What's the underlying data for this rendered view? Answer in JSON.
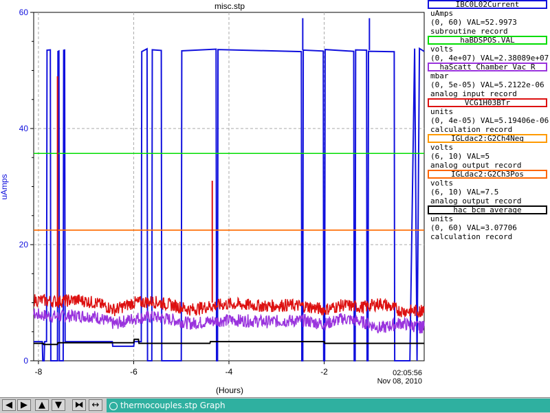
{
  "chart_data": {
    "type": "line",
    "title": "misc.stp",
    "xlabel": "(Hours)",
    "ylabel": "uAmps",
    "xlim": [
      -8.1,
      0.1
    ],
    "ylim": [
      0,
      60
    ],
    "x_ticks": [
      "-8",
      "-6",
      "-4",
      "-2"
    ],
    "y_ticks": [
      "0",
      "20",
      "40",
      "60"
    ],
    "time_label": "02:05:56",
    "date_label": "Nov 08, 2010",
    "grid": true,
    "series": [
      {
        "name": "IBC0L02Current",
        "color": "#1010dd",
        "x": [
          -8.1,
          -7.92,
          -7.91,
          -7.88,
          -7.87,
          -7.83,
          -7.82,
          -7.75,
          -7.74,
          -7.6,
          -7.59,
          -7.57,
          -7.56,
          -7.48,
          -7.47,
          -7.45,
          -7.44,
          -6.45,
          -6.44,
          -6.0,
          -5.99,
          -5.92,
          -5.9,
          -5.84,
          -5.83,
          -5.72,
          -5.71,
          -5.62,
          -5.61,
          -5.42,
          -5.41,
          -5.0,
          -4.99,
          -4.27,
          -4.26,
          -4.24,
          -4.23,
          -2.48,
          -2.47,
          -2.45,
          -2.44,
          -2.02,
          -2.01,
          -1.99,
          -1.98,
          -1.38,
          -1.37,
          -1.35,
          -1.34,
          -1.11,
          -1.1,
          -1.08,
          -1.07,
          -0.53,
          -0.52,
          -0.5,
          -0.45,
          -0.2,
          -0.1,
          -0.05,
          0.0,
          0.1
        ],
        "y": [
          3.3,
          3.3,
          0,
          0,
          3.3,
          3.3,
          53.5,
          53.5,
          0,
          0,
          53.5,
          53.5,
          0,
          0,
          53.5,
          53.5,
          3.3,
          3.3,
          2.5,
          2.5,
          3.3,
          3.3,
          3.3,
          3.3,
          53.5,
          53.5,
          0,
          0,
          53.5,
          53.5,
          0,
          0,
          53.5,
          53.5,
          0,
          0,
          53.5,
          53.5,
          0,
          0,
          53.5,
          53.5,
          0,
          0,
          53.5,
          53.5,
          0,
          0,
          53.5,
          53.5,
          0,
          0,
          53.5,
          53.5,
          0,
          0,
          0,
          0,
          53.5,
          0,
          53.5,
          53.5
        ]
      },
      {
        "name": "haBDSPOS.VAL",
        "color": "#00dd00",
        "x": [
          -8.1,
          0.1
        ],
        "y": [
          35.7,
          35.7
        ]
      },
      {
        "name": "haScatt_Chamber_Vac_R",
        "color": "#9933dd",
        "x": [
          -8.1,
          -7.6,
          -7.2,
          -6.8,
          -6.4,
          -6.0,
          -5.6,
          -5.2,
          -4.8,
          -4.4,
          -4.0,
          -3.6,
          -3.2,
          -2.8,
          -2.4,
          -2.0,
          -1.6,
          -1.2,
          -0.8,
          -0.4,
          0.0,
          0.1
        ],
        "y": [
          8.0,
          7.6,
          7.8,
          7.6,
          6.3,
          7.3,
          7.6,
          7.1,
          6.4,
          6.8,
          7.0,
          6.9,
          6.7,
          6.9,
          6.9,
          6.3,
          7.3,
          6.7,
          5.6,
          6.5,
          5.8,
          5.8
        ]
      },
      {
        "name": "VCG1H03BTr",
        "color": "#dd1010",
        "x": [
          -8.1,
          -7.6,
          -7.2,
          -6.8,
          -6.4,
          -6.0,
          -5.6,
          -5.2,
          -4.8,
          -4.4,
          -4.0,
          -3.6,
          -3.2,
          -2.8,
          -2.4,
          -2.0,
          -1.6,
          -1.2,
          -0.8,
          -0.4,
          0.0,
          0.1
        ],
        "y": [
          10.5,
          10.2,
          10.5,
          10.0,
          8.8,
          10.0,
          10.2,
          9.6,
          8.8,
          9.4,
          9.8,
          9.6,
          9.4,
          9.6,
          9.4,
          8.8,
          9.6,
          9.2,
          9.9,
          8.6,
          8.6,
          8.6
        ]
      },
      {
        "name": "IGLdac2:G2Ch4Neg",
        "color": "#ff9900",
        "x": [
          -8.1,
          0.1
        ],
        "y": [
          22.5,
          22.5
        ]
      },
      {
        "name": "IGLdac2:G2Ch3Pos",
        "color": "#ff6600",
        "x": [
          -8.1,
          0.1
        ],
        "y": [
          22.5,
          22.5
        ]
      },
      {
        "name": "hac_bcm_average",
        "color": "#000000",
        "x": [
          -8.1,
          -7.9,
          -7.89,
          -7.6,
          -7.59,
          -6.0,
          -5.99,
          -5.9,
          -5.89,
          -4.4,
          -4.39,
          -2.0,
          -1.99,
          0.1
        ],
        "y": [
          3.0,
          3.0,
          2.8,
          2.8,
          3.1,
          3.1,
          3.7,
          3.7,
          3.0,
          3.0,
          3.3,
          3.3,
          3.0,
          3.0
        ]
      }
    ],
    "spikes": [
      {
        "series": "VCG1H03BTr",
        "x": -7.6,
        "y": 49
      },
      {
        "series": "VCG1H03BTr",
        "x": -4.35,
        "y": 31
      },
      {
        "series": "IBC0L02Current",
        "x": -2.45,
        "y": 59
      },
      {
        "series": "IBC0L02Current",
        "x": -1.05,
        "y": 59
      }
    ]
  },
  "legend": [
    {
      "name": "IBC0L02Current",
      "color": "#1010dd",
      "line1": "uAmps",
      "line2": "(0, 60) VAL=52.9973",
      "line3": "subroutine record"
    },
    {
      "name": "haBDSPOS.VAL",
      "color": "#00dd00",
      "line1": "volts",
      "line2": "(0, 4e+07) VAL=2.38089e+07",
      "line3": ""
    },
    {
      "name": "haScatt_Chamber_Vac_R",
      "color": "#9933dd",
      "line1": "mbar",
      "line2": "(0, 5e-05) VAL=5.2122e-06",
      "line3": "analog input record"
    },
    {
      "name": "VCG1H03BTr",
      "color": "#dd1010",
      "line1": "units",
      "line2": "(0, 4e-05) VAL=5.19406e-06",
      "line3": "calculation record"
    },
    {
      "name": "IGLdac2:G2Ch4Neg",
      "color": "#ff9900",
      "line1": "volts",
      "line2": "(6, 10) VAL=5",
      "line3": "analog output record"
    },
    {
      "name": "IGLdac2:G2Ch3Pos",
      "color": "#ff6600",
      "line1": "volts",
      "line2": "(6, 10) VAL=7.5",
      "line3": "analog output record"
    },
    {
      "name": "hac_bcm_average",
      "color": "#000000",
      "line1": "units",
      "line2": "(0, 60) VAL=3.07706",
      "line3": "calculation record"
    }
  ],
  "toolbar": {
    "tab_label": "thermocouples.stp Graph"
  }
}
